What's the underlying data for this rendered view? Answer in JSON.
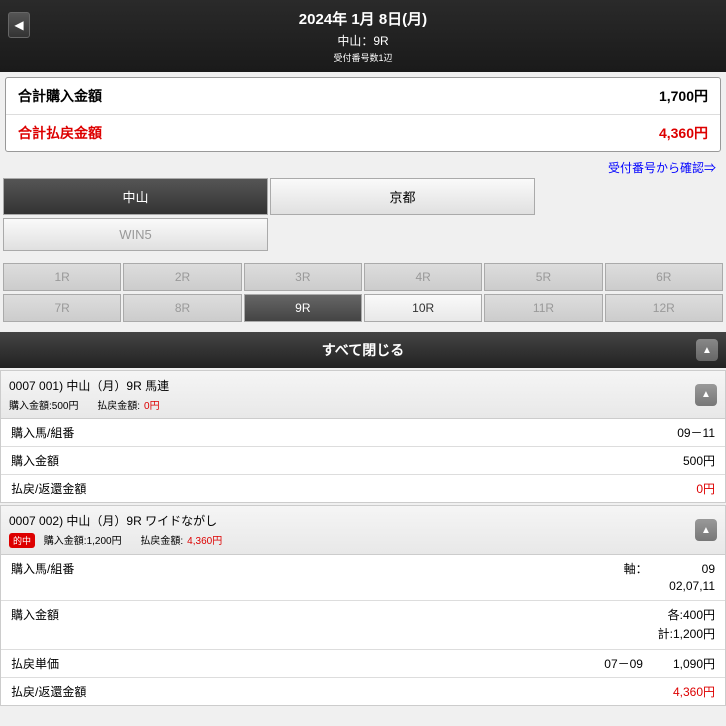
{
  "header": {
    "date": "2024年 1月 8日(月)",
    "race": "中山：9R",
    "sub": "受付番号数1辺"
  },
  "summary": {
    "purchase_label": "合計購入金額",
    "purchase_value": "1,700円",
    "payout_label": "合計払戻金額",
    "payout_value": "4,360円"
  },
  "confirm_link": "受付番号から確認⇒",
  "venues": {
    "items": [
      "中山",
      "京都"
    ],
    "win5": "WIN5"
  },
  "races": {
    "row1": [
      "1R",
      "2R",
      "3R",
      "4R",
      "5R",
      "6R"
    ],
    "row2": [
      "7R",
      "8R",
      "9R",
      "10R",
      "11R",
      "12R"
    ]
  },
  "collapse_all": "すべて閉じる",
  "bets": [
    {
      "id": "0007",
      "seq": "001)",
      "title": "中山（月）9R 馬連",
      "purchase_amt": "購入金額:500円",
      "payout_amt_label": "払戻金額:",
      "payout_amt": "0円",
      "hit": false,
      "rows": [
        {
          "label": "購入馬/組番",
          "value": "09－11"
        },
        {
          "label": "購入金額",
          "value": "500円"
        },
        {
          "label": "払戻/返還金額",
          "value": "0円",
          "red": true
        }
      ]
    },
    {
      "id": "0007",
      "seq": "002)",
      "title": "中山（月）9R ワイドながし",
      "purchase_amt": "購入金額:1,200円",
      "payout_amt_label": "払戻金額:",
      "payout_amt": "4,360円",
      "hit": true,
      "hit_label": "的中",
      "rows": [
        {
          "label": "購入馬/組番",
          "multi": [
            "軸：　　　　　09",
            "02,07,11"
          ]
        },
        {
          "label": "購入金額",
          "multi": [
            "各:400円",
            "計:1,200円"
          ]
        },
        {
          "label": "払戻単価",
          "mid": "07－09",
          "value": "1,090円"
        },
        {
          "label": "払戻/返還金額",
          "value": "4,360円",
          "red": true
        }
      ]
    }
  ]
}
